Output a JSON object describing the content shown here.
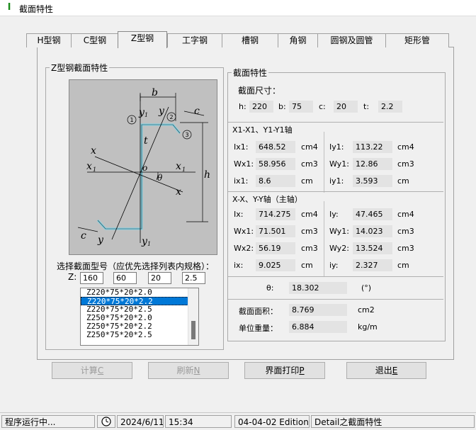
{
  "window": {
    "title": "截面特性",
    "app_icon": "I"
  },
  "tabs": [
    {
      "label": "H型钢"
    },
    {
      "label": "C型钢"
    },
    {
      "label": "Z型钢"
    },
    {
      "label": "工字钢"
    },
    {
      "label": "槽钢"
    },
    {
      "label": "角钢"
    },
    {
      "label": "圆钢及圆管"
    },
    {
      "label": "矩形管"
    }
  ],
  "section_group": {
    "title": "Z型钢截面特性"
  },
  "diagram": {
    "labels": {
      "b": "b",
      "c": "c",
      "t": "t",
      "h": "h",
      "x": "x",
      "y": "y",
      "x1": "x",
      "y1": "y",
      "sub1": "1",
      "o": "o",
      "theta": "θ",
      "pt1": "1",
      "pt2": "2",
      "pt3": "3"
    }
  },
  "select": {
    "title": "选择截面型号（应优先选择列表内规格）：",
    "z_label": "Z:",
    "inputs": [
      "160",
      "60",
      "20",
      "2.5"
    ],
    "list": [
      "Z220*75*20*2.0",
      "Z220*75*20*2.2",
      "Z220*75*20*2.5",
      "Z250*75*20*2.0",
      "Z250*75*20*2.2",
      "Z250*75*20*2.5"
    ],
    "selected_index": 1
  },
  "props": {
    "title": "截面特性",
    "dims_title": "截面尺寸：",
    "dims": {
      "h_label": "h:",
      "h": "220",
      "b_label": "b:",
      "b": "75",
      "c_label": "c:",
      "c": "20",
      "t_label": "t:",
      "t": "2.2"
    },
    "axis1_title": "X1-X1、Y1-Y1轴",
    "axis1": [
      {
        "l": "Ix1:",
        "v": "648.52",
        "u": "cm4",
        "l2": "Iy1:",
        "v2": "113.22",
        "u2": "cm4"
      },
      {
        "l": "Wx1:",
        "v": "58.956",
        "u": "cm3",
        "l2": "Wy1:",
        "v2": "12.86",
        "u2": "cm3"
      },
      {
        "l": "ix1:",
        "v": "8.6",
        "u": "cm",
        "l2": "iy1:",
        "v2": "3.593",
        "u2": "cm"
      }
    ],
    "axis2_title": "X-X、Y-Y轴（主轴）",
    "axis2": [
      {
        "l": "Ix:",
        "v": "714.275",
        "u": "cm4",
        "l2": "Iy:",
        "v2": "47.465",
        "u2": "cm4"
      },
      {
        "l": "Wx1:",
        "v": "71.501",
        "u": "cm3",
        "l2": "Wy1:",
        "v2": "14.023",
        "u2": "cm3"
      },
      {
        "l": "Wx2:",
        "v": "56.19",
        "u": "cm3",
        "l2": "Wy2:",
        "v2": "13.524",
        "u2": "cm3"
      },
      {
        "l": "ix:",
        "v": "9.025",
        "u": "cm",
        "l2": "iy:",
        "v2": "2.327",
        "u2": "cm"
      }
    ],
    "theta": {
      "l": "θ:",
      "v": "18.302",
      "u": "(°)"
    },
    "area": {
      "l": "截面面积：",
      "v": "8.769",
      "u": "cm2"
    },
    "weight": {
      "l": "单位重量：",
      "v": "6.884",
      "u": "kg/m"
    }
  },
  "buttons": {
    "calc": "计算",
    "calc_key": "C",
    "refresh": "刷新",
    "refresh_key": "N",
    "print": "界面打印",
    "print_key": "P",
    "exit": "退出",
    "exit_key": "E"
  },
  "status": {
    "running": "程序运行中...",
    "clock_icon": "clock-icon",
    "date": "2024/6/11",
    "time": "15:34",
    "edition": "04-04-02 Edition",
    "detail": "Detail之截面特性"
  },
  "colors": {
    "selection": "#0078d7",
    "profile": "#7fd3e6"
  }
}
